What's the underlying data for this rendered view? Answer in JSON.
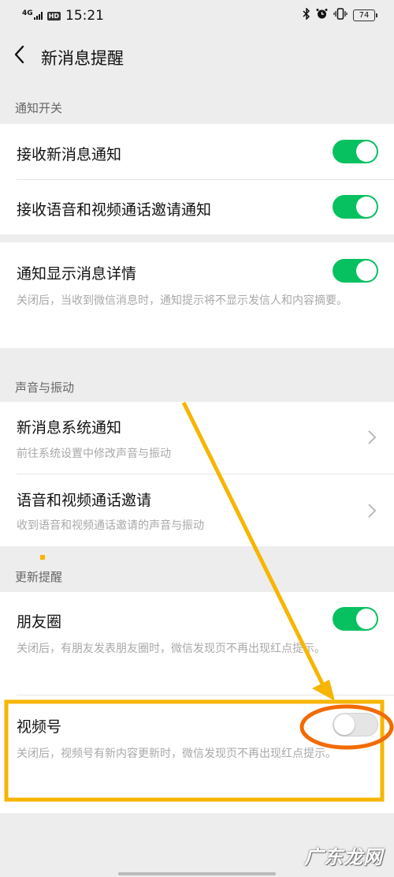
{
  "status_bar": {
    "network": "4G",
    "hd": "HD",
    "time": "15:21",
    "battery": "74"
  },
  "header": {
    "title": "新消息提醒"
  },
  "sections": {
    "notification_switch": {
      "header": "通知开关",
      "receive_new": {
        "label": "接收新消息通知",
        "on": true
      },
      "receive_call": {
        "label": "接收语音和视频通话邀请通知",
        "on": true
      },
      "show_details": {
        "label": "通知显示消息详情",
        "desc": "关闭后，当收到微信消息时，通知提示将不显示发信人和内容摘要。",
        "on": true
      }
    },
    "sound_vibration": {
      "header": "声音与振动",
      "system_notify": {
        "label": "新消息系统通知",
        "desc": "前往系统设置中修改声音与振动"
      },
      "call_invite": {
        "label": "语音和视频通话邀请",
        "desc": "收到语音和视频通话邀请的声音与振动"
      }
    },
    "update_reminder": {
      "header": "更新提醒",
      "moments": {
        "label": "朋友圈",
        "desc": "关闭后，有朋友发表朋友圈时，微信发现页不再出现红点提示。",
        "on": true
      },
      "channels": {
        "label": "视频号",
        "desc": "关闭后，视频号有新内容更新时，微信发现页不再出现红点提示。",
        "on": false
      }
    }
  },
  "watermark": "广东龙网",
  "colors": {
    "toggle_on": "#07c160",
    "toggle_off": "#e5e5e5",
    "annotation_arrow": "#f7b500",
    "annotation_circle": "#f36a00"
  }
}
